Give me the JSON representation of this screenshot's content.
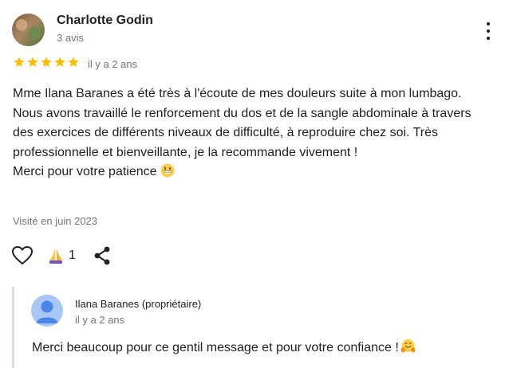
{
  "review": {
    "author_name": "Charlotte Godin",
    "author_review_count": "3 avis",
    "more_icon": "more-vert-icon",
    "rating": 5,
    "max_rating": 5,
    "time_ago": "il y a 2 ans",
    "text_line_1": "Mme Ilana Baranes a été très à l'écoute de mes douleurs suite à mon lumbago. Nous avons travaillé le renforcement du dos et de la sangle abdominale à travers des exercices de différents niveaux de difficulté, à reproduire chez soi. Très professionnelle et bienveillante, je la recommande vivement !",
    "text_line_2": "Merci pour votre patience",
    "text_emoji": "grinning-face-emoji",
    "visited": "Visité en juin 2023"
  },
  "actions": {
    "like_icon": "heart-outline-icon",
    "thanks_icon": "folded-hands-icon",
    "thanks_count": "1",
    "share_icon": "share-icon"
  },
  "reply": {
    "owner_name": "Ilana Baranes (propriétaire)",
    "time_ago": "il y a 2 ans",
    "text": "Merci beaucoup pour ce gentil message et pour votre confiance !",
    "text_emoji": "hugging-face-emoji"
  },
  "colors": {
    "star": "#fbbc04",
    "secondary_text": "#70757a",
    "owner_avatar": "#a9c7f5",
    "owner_avatar_figure": "#4a86e8",
    "reply_border": "#dadce0"
  }
}
